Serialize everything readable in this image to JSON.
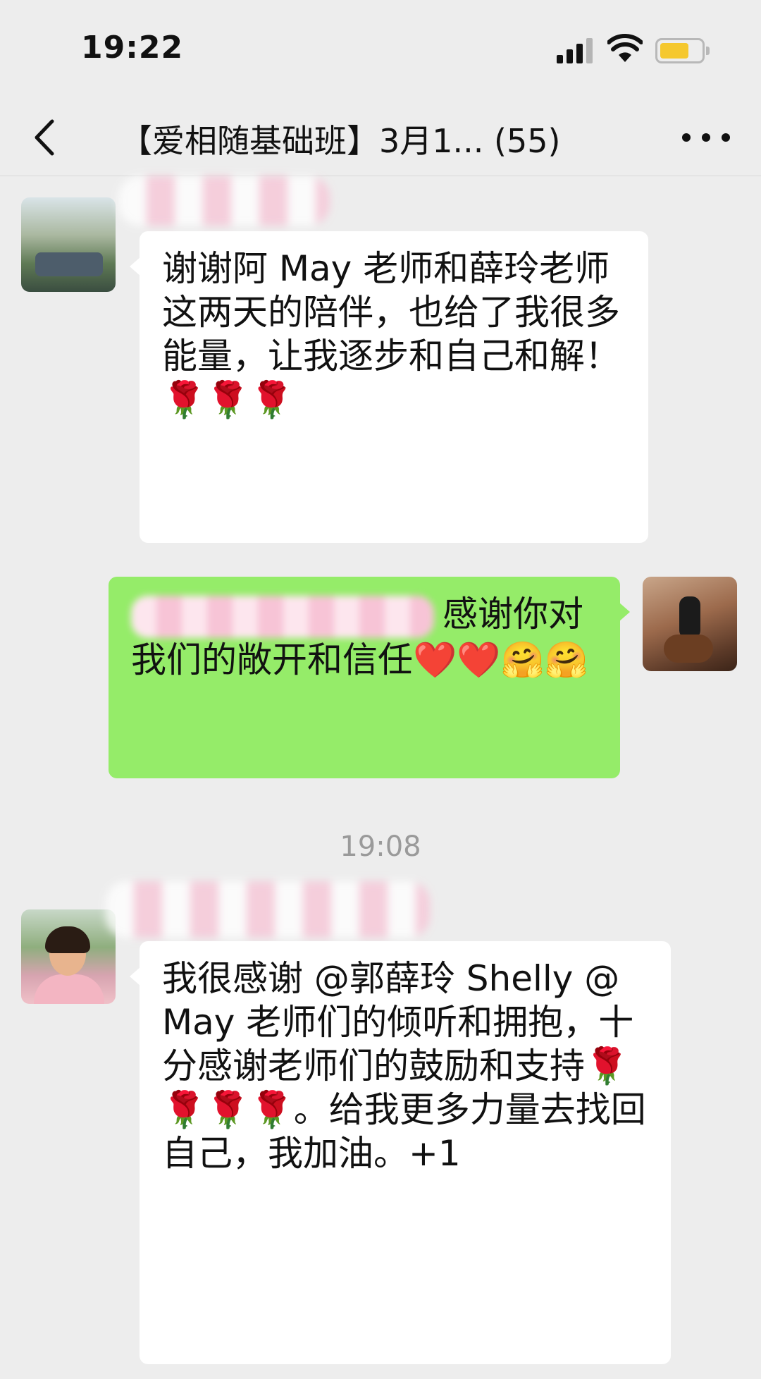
{
  "status": {
    "time": "19:22"
  },
  "nav": {
    "title": "【爱相随基础班】3月1... (55)"
  },
  "messages": [
    {
      "side": "left",
      "text": "谢谢阿 May 老师和薛玲老师这两天的陪伴，也给了我很多能量，让我逐步和自己和解！🌹🌹🌹"
    },
    {
      "side": "right",
      "text": "感谢你对我们的敞开和信任❤️❤️🤗🤗"
    },
    {
      "side": "left",
      "text": "我很感谢 @郭薛玲 Shelly @May 老师们的倾听和拥抱，十分感谢老师们的鼓励和支持🌹🌹🌹🌹。给我更多力量去找回自己，我加油。+1"
    }
  ],
  "time_divider": "19:08",
  "colors": {
    "background": "#ededed",
    "bubble_self": "#95ec69",
    "bubble_other": "#ffffff",
    "battery": "#f5c82e"
  }
}
